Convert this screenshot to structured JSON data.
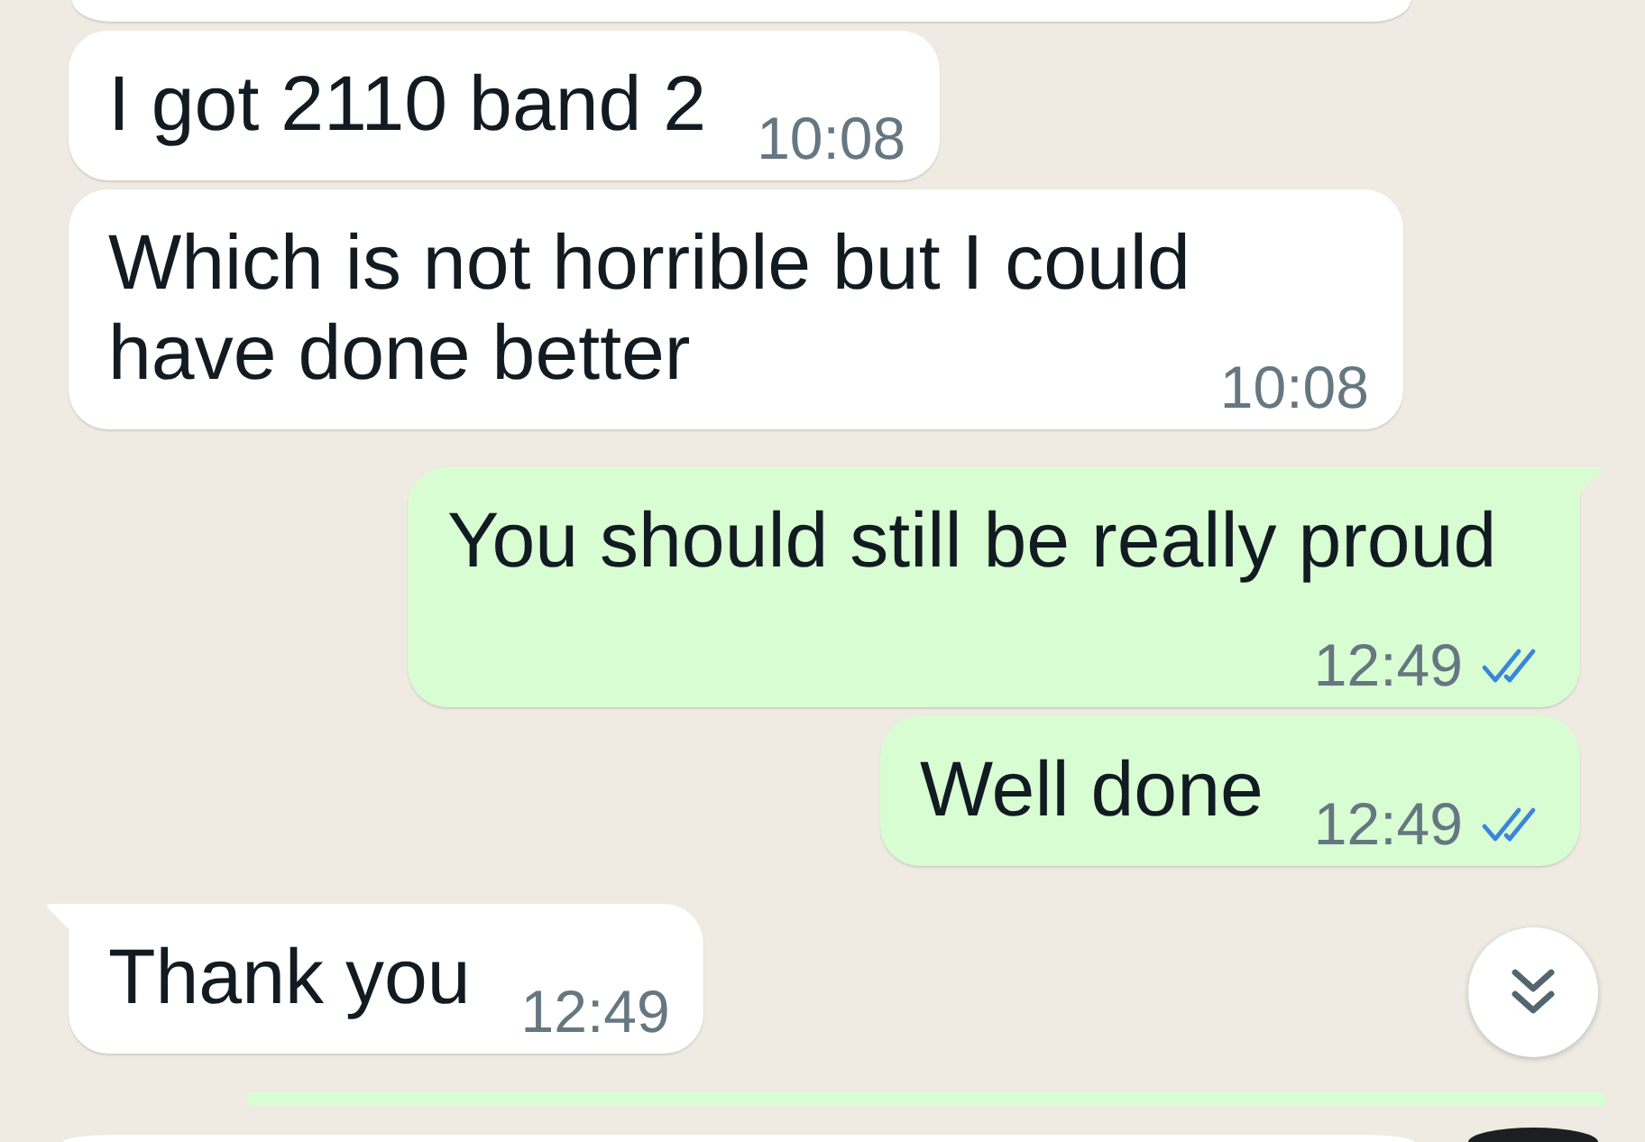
{
  "messages": [
    {
      "kind": "incoming",
      "clipped": true,
      "tail": false
    },
    {
      "kind": "incoming",
      "clipped": false,
      "text": "I got 2110 band 2",
      "time": "10:08",
      "tail": false
    },
    {
      "kind": "incoming",
      "clipped": false,
      "text": "Which is not horrible but I could have done better",
      "time": "10:08",
      "tail": false
    },
    {
      "kind": "outgoing",
      "clipped": false,
      "text": "You should still be really proud",
      "time": "12:49",
      "tail": true,
      "read": true
    },
    {
      "kind": "outgoing",
      "clipped": false,
      "text": "Well done",
      "time": "12:49",
      "tail": false,
      "read": true
    },
    {
      "kind": "incoming",
      "clipped": false,
      "text": "Thank you",
      "time": "12:49",
      "tail": true
    },
    {
      "kind": "outgoing",
      "clipped": true,
      "tail": false
    }
  ],
  "overlays": [
    {
      "kind": "scroll-down"
    }
  ],
  "composer": [
    {
      "kind": "field"
    },
    {
      "kind": "round-button"
    }
  ]
}
